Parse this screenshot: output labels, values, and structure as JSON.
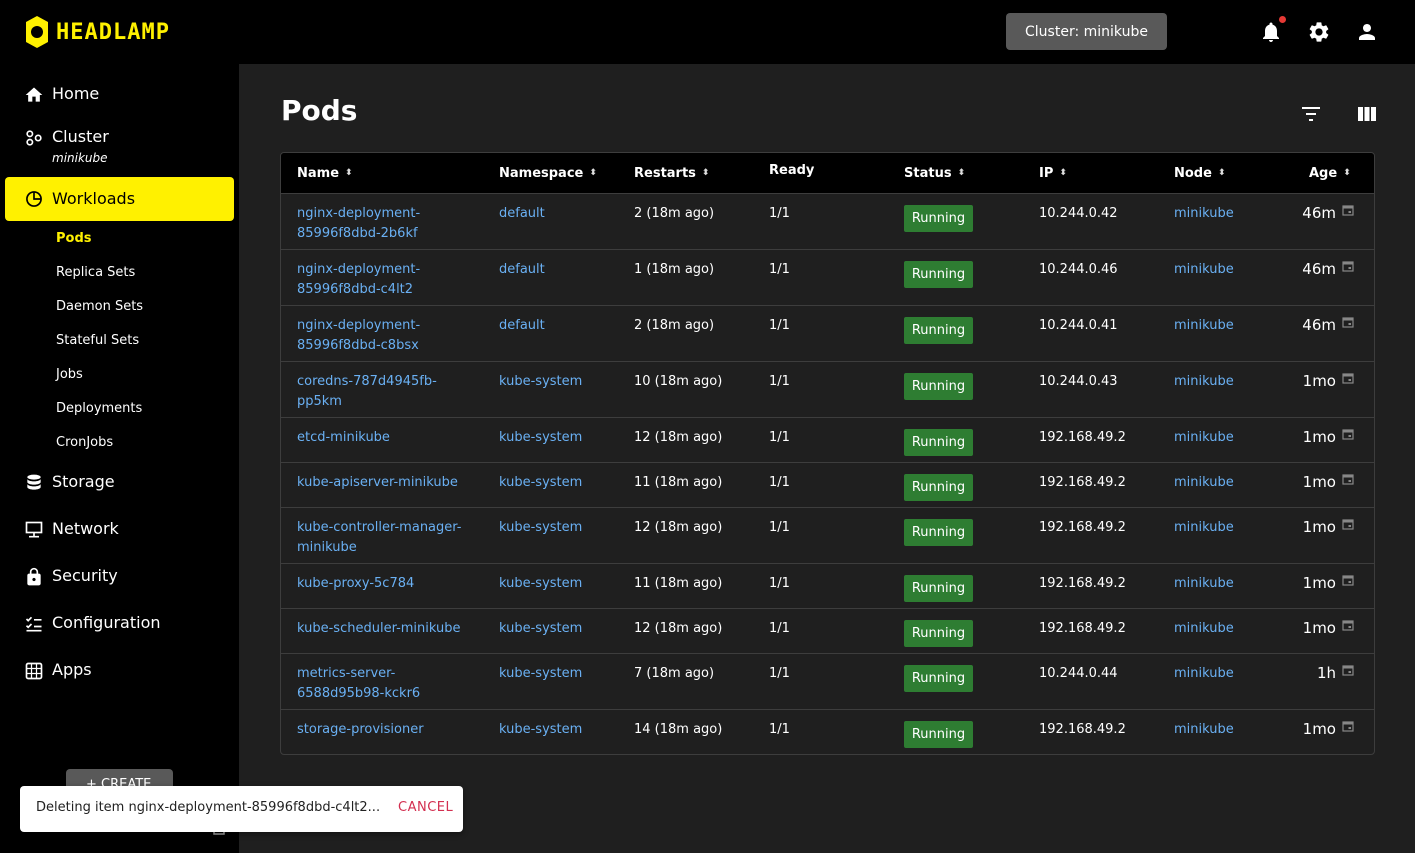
{
  "app": {
    "logo_text": "HEADLAMP"
  },
  "topbar": {
    "cluster_button": "Cluster: minikube",
    "icons": [
      "bell-icon",
      "gear-icon",
      "user-icon"
    ],
    "notification_color": "#e53935"
  },
  "sidebar": {
    "items": [
      {
        "label": "Home",
        "icon": "home-icon"
      },
      {
        "label": "Cluster",
        "sub": "minikube",
        "icon": "cluster-icon"
      },
      {
        "label": "Workloads",
        "icon": "workloads-icon",
        "active": true
      },
      {
        "label": "Storage",
        "icon": "storage-icon"
      },
      {
        "label": "Network",
        "icon": "network-icon"
      },
      {
        "label": "Security",
        "icon": "lock-icon"
      },
      {
        "label": "Configuration",
        "icon": "config-icon"
      },
      {
        "label": "Apps",
        "icon": "apps-icon"
      }
    ],
    "workload_subitems": [
      "Pods",
      "Replica Sets",
      "Daemon Sets",
      "Stateful Sets",
      "Jobs",
      "Deployments",
      "CronJobs"
    ],
    "active_subitem": "Pods",
    "accent": "#fff100"
  },
  "main": {
    "title": "Pods",
    "columns": [
      "Name",
      "Namespace",
      "Restarts",
      "Ready",
      "Status",
      "IP",
      "Node",
      "Age"
    ],
    "rows": [
      {
        "name": "nginx-deployment-85996f8dbd-2b6kf",
        "namespace": "default",
        "restarts": "2 (18m ago)",
        "ready": "1/1",
        "status": "Running",
        "ip": "10.244.0.42",
        "node": "minikube",
        "age": "46m"
      },
      {
        "name": "nginx-deployment-85996f8dbd-c4lt2",
        "namespace": "default",
        "restarts": "1 (18m ago)",
        "ready": "1/1",
        "status": "Running",
        "ip": "10.244.0.46",
        "node": "minikube",
        "age": "46m"
      },
      {
        "name": "nginx-deployment-85996f8dbd-c8bsx",
        "namespace": "default",
        "restarts": "2 (18m ago)",
        "ready": "1/1",
        "status": "Running",
        "ip": "10.244.0.41",
        "node": "minikube",
        "age": "46m"
      },
      {
        "name": "coredns-787d4945fb-pp5km",
        "namespace": "kube-system",
        "restarts": "10 (18m ago)",
        "ready": "1/1",
        "status": "Running",
        "ip": "10.244.0.43",
        "node": "minikube",
        "age": "1mo"
      },
      {
        "name": "etcd-minikube",
        "namespace": "kube-system",
        "restarts": "12 (18m ago)",
        "ready": "1/1",
        "status": "Running",
        "ip": "192.168.49.2",
        "node": "minikube",
        "age": "1mo"
      },
      {
        "name": "kube-apiserver-minikube",
        "namespace": "kube-system",
        "restarts": "11 (18m ago)",
        "ready": "1/1",
        "status": "Running",
        "ip": "192.168.49.2",
        "node": "minikube",
        "age": "1mo"
      },
      {
        "name": "kube-controller-manager-minikube",
        "namespace": "kube-system",
        "restarts": "12 (18m ago)",
        "ready": "1/1",
        "status": "Running",
        "ip": "192.168.49.2",
        "node": "minikube",
        "age": "1mo"
      },
      {
        "name": "kube-proxy-5c784",
        "namespace": "kube-system",
        "restarts": "11 (18m ago)",
        "ready": "1/1",
        "status": "Running",
        "ip": "192.168.49.2",
        "node": "minikube",
        "age": "1mo"
      },
      {
        "name": "kube-scheduler-minikube",
        "namespace": "kube-system",
        "restarts": "12 (18m ago)",
        "ready": "1/1",
        "status": "Running",
        "ip": "192.168.49.2",
        "node": "minikube",
        "age": "1mo"
      },
      {
        "name": "metrics-server-6588d95b98-kckr6",
        "namespace": "kube-system",
        "restarts": "7 (18m ago)",
        "ready": "1/1",
        "status": "Running",
        "ip": "10.244.0.44",
        "node": "minikube",
        "age": "1h"
      },
      {
        "name": "storage-provisioner",
        "namespace": "kube-system",
        "restarts": "14 (18m ago)",
        "ready": "1/1",
        "status": "Running",
        "ip": "192.168.49.2",
        "node": "minikube",
        "age": "1mo"
      }
    ],
    "status_color": "#2e7d32",
    "link_color": "#6ab0f3"
  },
  "create_button": "+ CREATE",
  "snackbar": {
    "message": "Deleting item nginx-deployment-85996f8dbd-c4lt2...",
    "action": "CANCEL"
  }
}
